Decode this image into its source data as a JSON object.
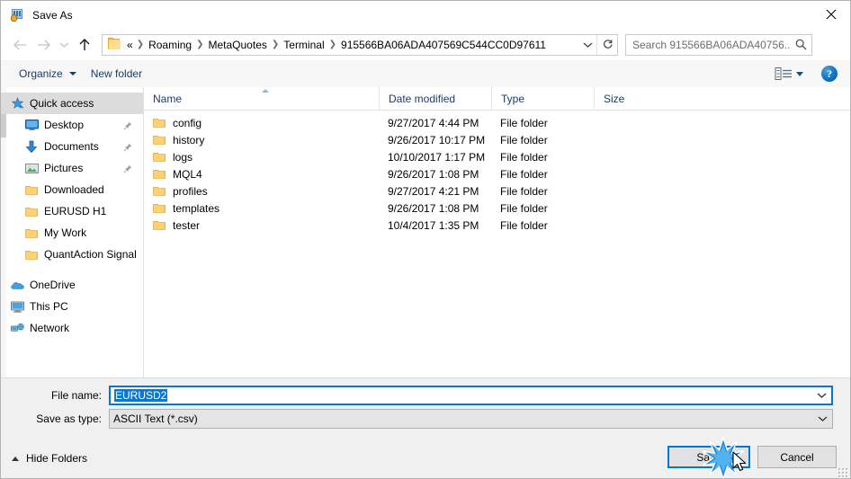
{
  "window": {
    "title": "Save As",
    "app_icon": "save-as-app-icon",
    "close_label": "✕"
  },
  "nav": {
    "back_icon": "arrow-left-icon",
    "forward_icon": "arrow-right-icon",
    "recent_icon": "chevron-down-icon",
    "up_icon": "arrow-up-icon",
    "refresh_icon": "refresh-icon",
    "dropdown_icon": "chevron-down-icon",
    "folder_icon": "folder-icon"
  },
  "address": {
    "prefix": "«",
    "crumbs": [
      "Roaming",
      "MetaQuotes",
      "Terminal",
      "915566BA06ADA407569C544CC0D97611"
    ],
    "separator": "❯"
  },
  "search": {
    "placeholder": "Search 915566BA06ADA40756...",
    "icon": "search-icon"
  },
  "toolbar": {
    "organize_label": "Organize",
    "new_folder_label": "New folder",
    "view_icon": "view-layout-icon",
    "help_label": "?"
  },
  "sidebar": {
    "items": [
      {
        "label": "Quick access",
        "icon": "star-pin-icon",
        "selected": true,
        "indent": false,
        "pinned": false
      },
      {
        "label": "Desktop",
        "icon": "desktop-icon",
        "selected": false,
        "indent": true,
        "pinned": true
      },
      {
        "label": "Documents",
        "icon": "documents-download-icon",
        "selected": false,
        "indent": true,
        "pinned": true
      },
      {
        "label": "Pictures",
        "icon": "pictures-icon",
        "selected": false,
        "indent": true,
        "pinned": true
      },
      {
        "label": "Downloaded",
        "icon": "folder-icon",
        "selected": false,
        "indent": true,
        "pinned": false
      },
      {
        "label": "EURUSD H1",
        "icon": "folder-icon",
        "selected": false,
        "indent": true,
        "pinned": false
      },
      {
        "label": "My Work",
        "icon": "folder-icon",
        "selected": false,
        "indent": true,
        "pinned": false
      },
      {
        "label": "QuantAction Signal",
        "icon": "folder-icon",
        "selected": false,
        "indent": true,
        "pinned": false
      },
      {
        "label": "OneDrive",
        "icon": "onedrive-cloud-icon",
        "selected": false,
        "indent": false,
        "pinned": false
      },
      {
        "label": "This PC",
        "icon": "this-pc-monitor-icon",
        "selected": false,
        "indent": false,
        "pinned": false
      },
      {
        "label": "Network",
        "icon": "network-icon",
        "selected": false,
        "indent": false,
        "pinned": false
      }
    ]
  },
  "filelist": {
    "columns": [
      "Name",
      "Date modified",
      "Type",
      "Size"
    ],
    "sort_column": "Name",
    "sort_direction": "ascending",
    "rows": [
      {
        "name": "config",
        "date": "9/27/2017 4:44 PM",
        "type": "File folder",
        "size": ""
      },
      {
        "name": "history",
        "date": "9/26/2017 10:17 PM",
        "type": "File folder",
        "size": ""
      },
      {
        "name": "logs",
        "date": "10/10/2017 1:17 PM",
        "type": "File folder",
        "size": ""
      },
      {
        "name": "MQL4",
        "date": "9/26/2017 1:08 PM",
        "type": "File folder",
        "size": ""
      },
      {
        "name": "profiles",
        "date": "9/27/2017 4:21 PM",
        "type": "File folder",
        "size": ""
      },
      {
        "name": "templates",
        "date": "9/26/2017 1:08 PM",
        "type": "File folder",
        "size": ""
      },
      {
        "name": "tester",
        "date": "10/4/2017 1:35 PM",
        "type": "File folder",
        "size": ""
      }
    ]
  },
  "form": {
    "filename_label": "File name:",
    "filename_value": "EURUSD2",
    "savetype_label": "Save as type:",
    "savetype_value": "ASCII Text (*.csv)",
    "dropdown_icon": "chevron-down-icon"
  },
  "footer": {
    "hide_folders_label": "Hide Folders",
    "save_label": "Save",
    "cancel_label": "Cancel"
  },
  "colors": {
    "accent": "#0078d7",
    "selection": "#0a78d2",
    "header_text": "#1c3c68",
    "folder": "#ffd176",
    "footer_bg": "#f0f0f0"
  }
}
